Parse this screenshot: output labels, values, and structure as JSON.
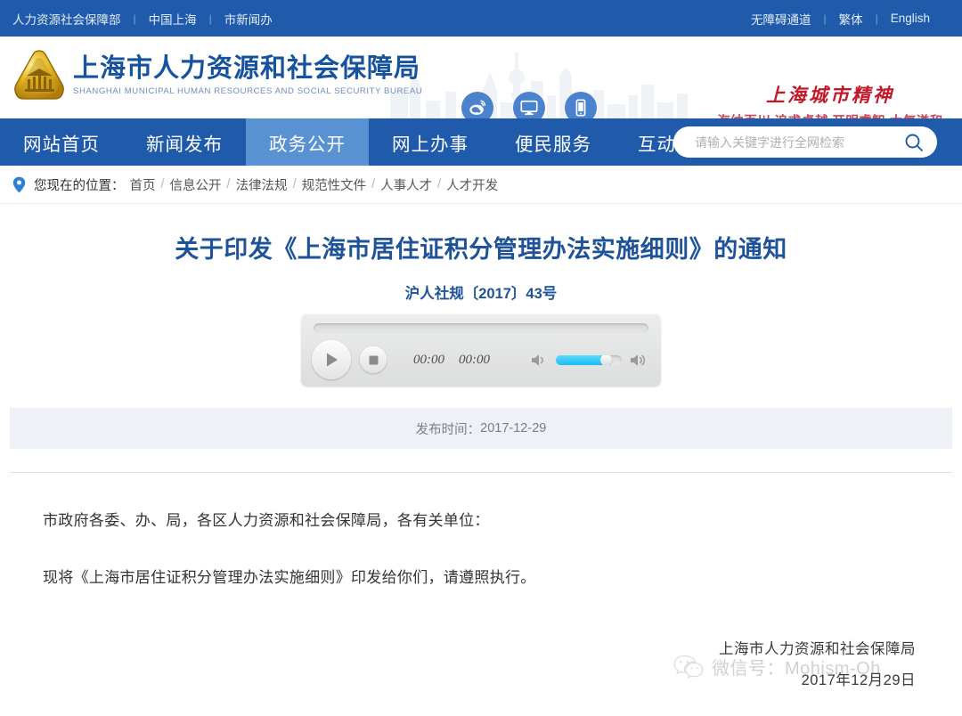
{
  "topbar": {
    "left_links": [
      "人力资源社会保障部",
      "中国上海",
      "市新闻办"
    ],
    "right_links": [
      "无障碍通道",
      "繁体",
      "English"
    ],
    "separator": "|",
    "bg_color": "#1f5baa"
  },
  "header": {
    "logo_cn": "上海市人力资源和社会保障局",
    "logo_en": "SHANGHAI MUNICIPAL HUMAN RESOURCES AND SOCIAL SECURITY BUREAU",
    "logo_color": "#16539f",
    "social_icons": [
      {
        "name": "weibo-icon",
        "label": "微博"
      },
      {
        "name": "desktop-icon",
        "label": "电脑版"
      },
      {
        "name": "mobile-icon",
        "label": "手机版"
      }
    ],
    "spirit_title": "上海城市精神",
    "spirit_sub": "海纳百川 追求卓越 开明睿智 大气谦和",
    "spirit_color": "#c2192a"
  },
  "nav": {
    "items": [
      {
        "label": "网站首页",
        "active": false
      },
      {
        "label": "新闻发布",
        "active": false
      },
      {
        "label": "政务公开",
        "active": true
      },
      {
        "label": "网上办事",
        "active": false
      },
      {
        "label": "便民服务",
        "active": false
      },
      {
        "label": "互动交流",
        "active": false
      }
    ],
    "active_bg": "#5892d2"
  },
  "search": {
    "placeholder": "请输入关键字进行全网检索",
    "value": "",
    "icon": "search-icon"
  },
  "breadcrumb": {
    "icon": "location-pin-icon",
    "label": "您现在的位置：",
    "items": [
      "首页",
      "信息公开",
      "法律法规",
      "规范性文件",
      "人事人才",
      "人才开发"
    ],
    "separator": "/"
  },
  "article": {
    "title": "关于印发《上海市居住证积分管理办法实施细则》的通知",
    "doc_number": "沪人社规〔2017〕43号",
    "publish_label": "发布时间：",
    "publish_date": "2017-12-29",
    "paragraphs": [
      "市政府各委、办、局，各区人力资源和社会保障局，各有关单位：",
      "现将《上海市居住证积分管理办法实施细则》印发给你们，请遵照执行。"
    ],
    "signature_org": "上海市人力资源和社会保障局",
    "signature_date": "2017年12月29日"
  },
  "audio_player": {
    "play_button": "play-button",
    "stop_button": "stop-button",
    "current_time": "00:00",
    "total_time": "00:00",
    "volume_percent": 78,
    "volume_fill_color": "#18bdf2",
    "mute_icon": "volume-low-icon",
    "max_icon": "volume-high-icon"
  },
  "watermark": {
    "icon": "wechat-icon",
    "text": "微信号：Mohism-Qh"
  }
}
